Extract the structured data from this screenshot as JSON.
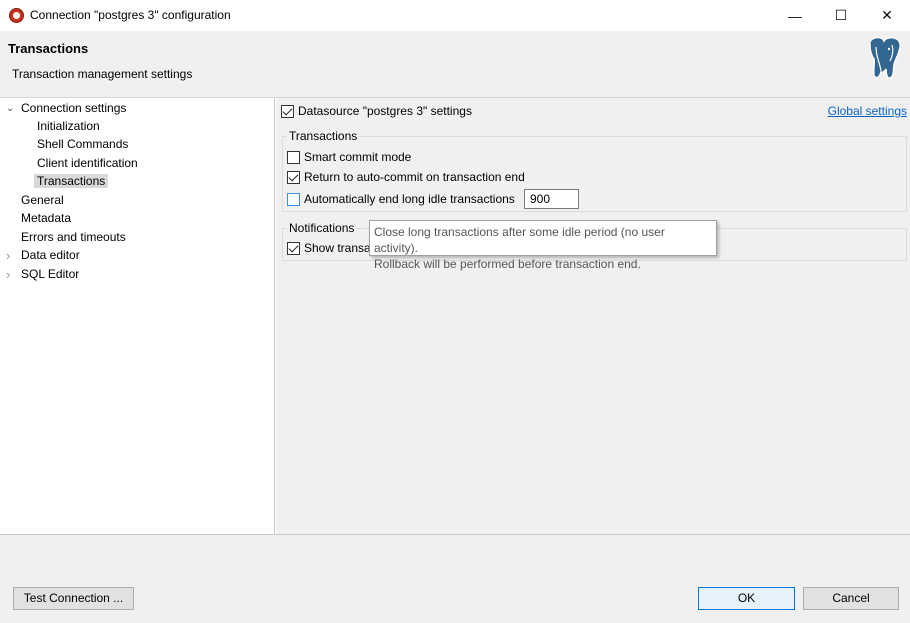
{
  "window": {
    "title": "Connection \"postgres 3\" configuration",
    "minimize": "—",
    "maximize": "☐",
    "close": "✕"
  },
  "header": {
    "title": "Transactions",
    "subtitle": "Transaction management settings"
  },
  "tree": {
    "items": [
      {
        "label": "Connection settings",
        "arrow": "⌄"
      },
      {
        "label": "Initialization"
      },
      {
        "label": "Shell Commands"
      },
      {
        "label": "Client identification"
      },
      {
        "label": "Transactions"
      },
      {
        "label": "General"
      },
      {
        "label": "Metadata"
      },
      {
        "label": "Errors and timeouts"
      },
      {
        "label": "Data editor",
        "arrow": "›"
      },
      {
        "label": "SQL Editor",
        "arrow": "›"
      }
    ]
  },
  "content": {
    "datasource_label": "Datasource \"postgres 3\" settings",
    "global_settings_link": "Global settings",
    "transactions_group": {
      "title": "Transactions",
      "smart_commit": "Smart commit mode",
      "return_autocommit": "Return to auto-commit on transaction end",
      "auto_end_idle": "Automatically end long idle transactions",
      "idle_value": "900"
    },
    "notifications_group": {
      "title": "Notifications",
      "show_transactions": "Show transac"
    },
    "tooltip": {
      "line1": "Close long transactions after some idle period (no user activity).",
      "line2": "Rollback will be performed before transaction end."
    }
  },
  "footer": {
    "test_connection": "Test Connection ...",
    "ok": "OK",
    "cancel": "Cancel"
  },
  "colors": {
    "accent": "#0078d7",
    "link": "#0b63c7",
    "panel": "#f0f0f0"
  }
}
